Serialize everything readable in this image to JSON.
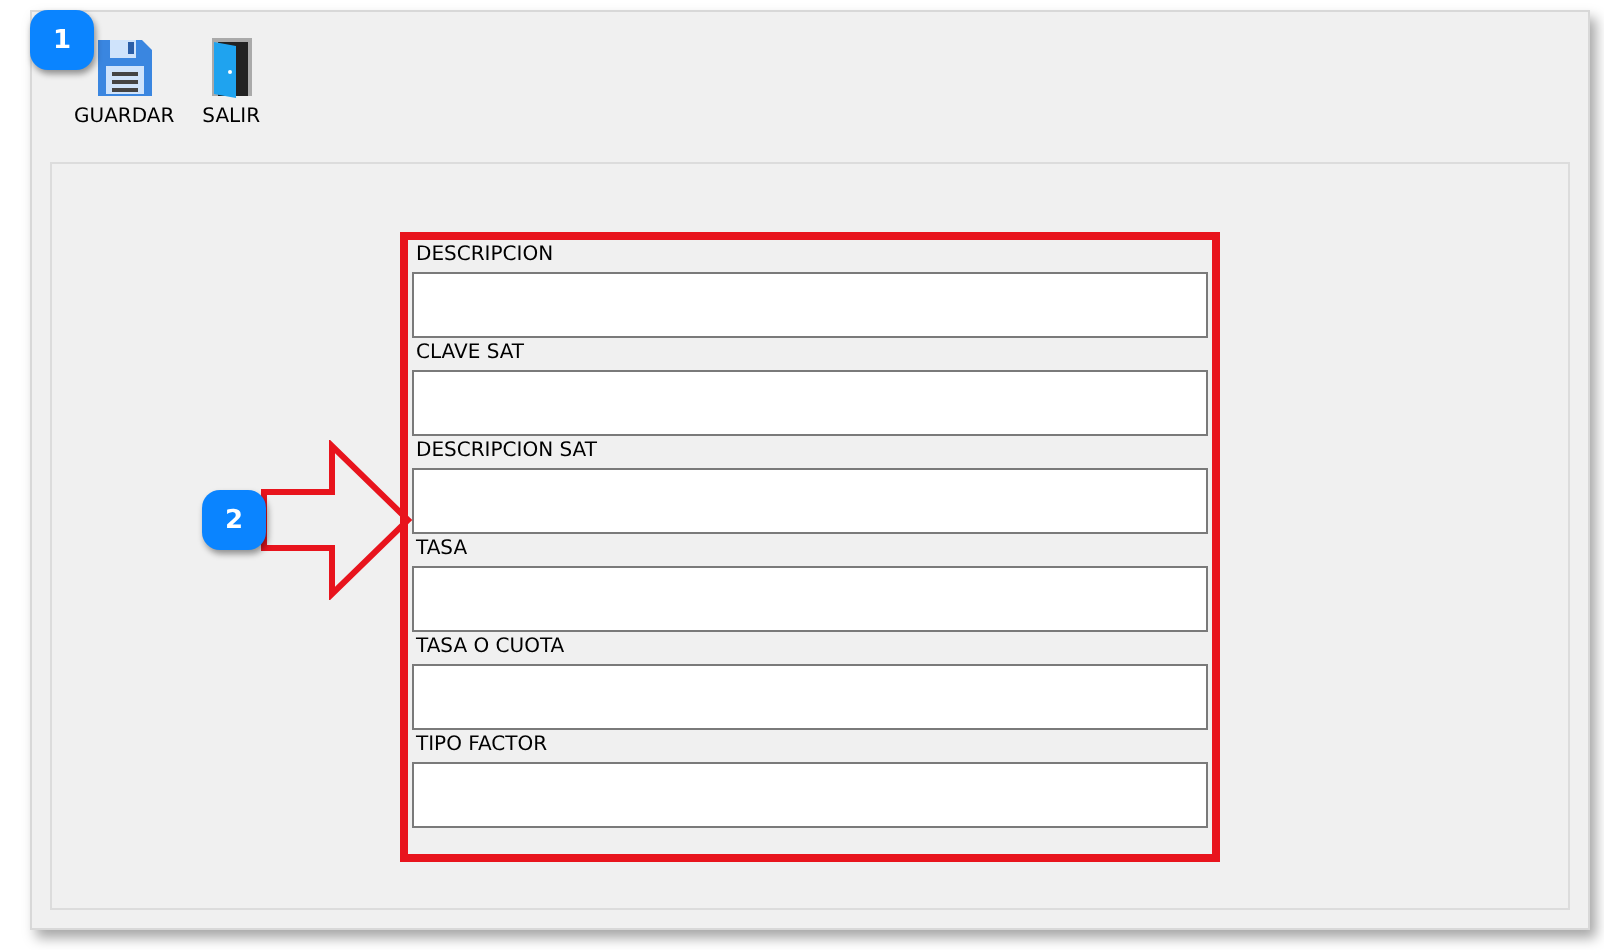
{
  "toolbar": [
    {
      "kind": "save",
      "label": "GUARDAR"
    },
    {
      "kind": "exit",
      "label": "SALIR"
    }
  ],
  "form": {
    "fields": [
      {
        "label": "DESCRIPCION"
      },
      {
        "label": "CLAVE SAT"
      },
      {
        "label": "DESCRIPCION SAT"
      },
      {
        "label": "TASA"
      },
      {
        "label": "TASA O CUOTA"
      },
      {
        "label": "TIPO FACTOR"
      }
    ]
  },
  "callouts": [
    {
      "kind": "badge",
      "text": "1"
    },
    {
      "kind": "arrow",
      "text": "2"
    }
  ]
}
